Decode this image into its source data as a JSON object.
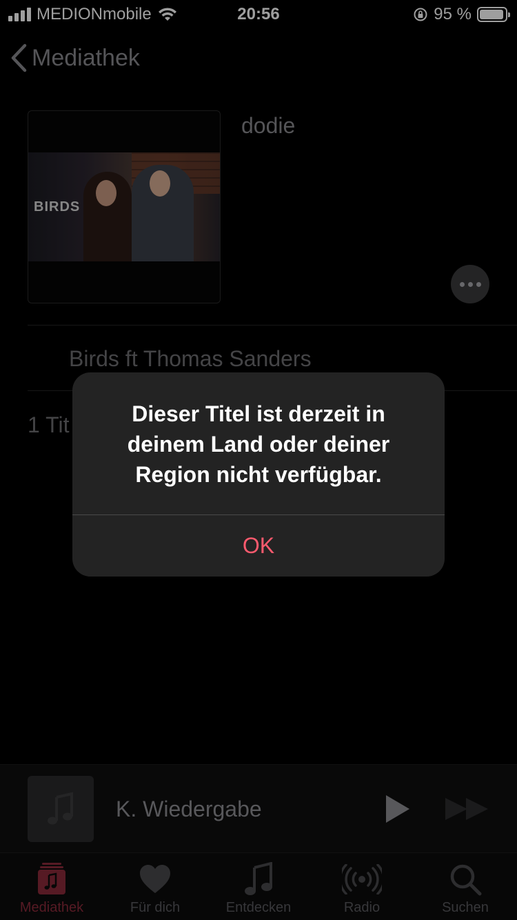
{
  "status_bar": {
    "carrier": "MEDIONmobile",
    "time": "20:56",
    "battery_percent": "95 %",
    "battery_level": 0.95
  },
  "nav": {
    "back_label": "Mediathek"
  },
  "album": {
    "artwork_text": "BIRDS",
    "artist": "dodie",
    "track_title": "Birds ft Thomas Sanders",
    "track_count": "1 Tit"
  },
  "mini_player": {
    "title": "K. Wiedergabe"
  },
  "tab_bar": {
    "tabs": [
      {
        "label": "Mediathek",
        "icon": "library-icon",
        "active": true
      },
      {
        "label": "Für dich",
        "icon": "heart-icon",
        "active": false
      },
      {
        "label": "Entdecken",
        "icon": "music-note-icon",
        "active": false
      },
      {
        "label": "Radio",
        "icon": "radio-icon",
        "active": false
      },
      {
        "label": "Suchen",
        "icon": "search-icon",
        "active": false
      }
    ]
  },
  "alert": {
    "message": "Dieser Titel ist derzeit in deinem Land oder deiner Region nicht verfügbar.",
    "ok_label": "OK"
  },
  "colors": {
    "accent": "#ff5a6e",
    "active_tab": "#8c2a3a",
    "alert_background": "#232323"
  }
}
